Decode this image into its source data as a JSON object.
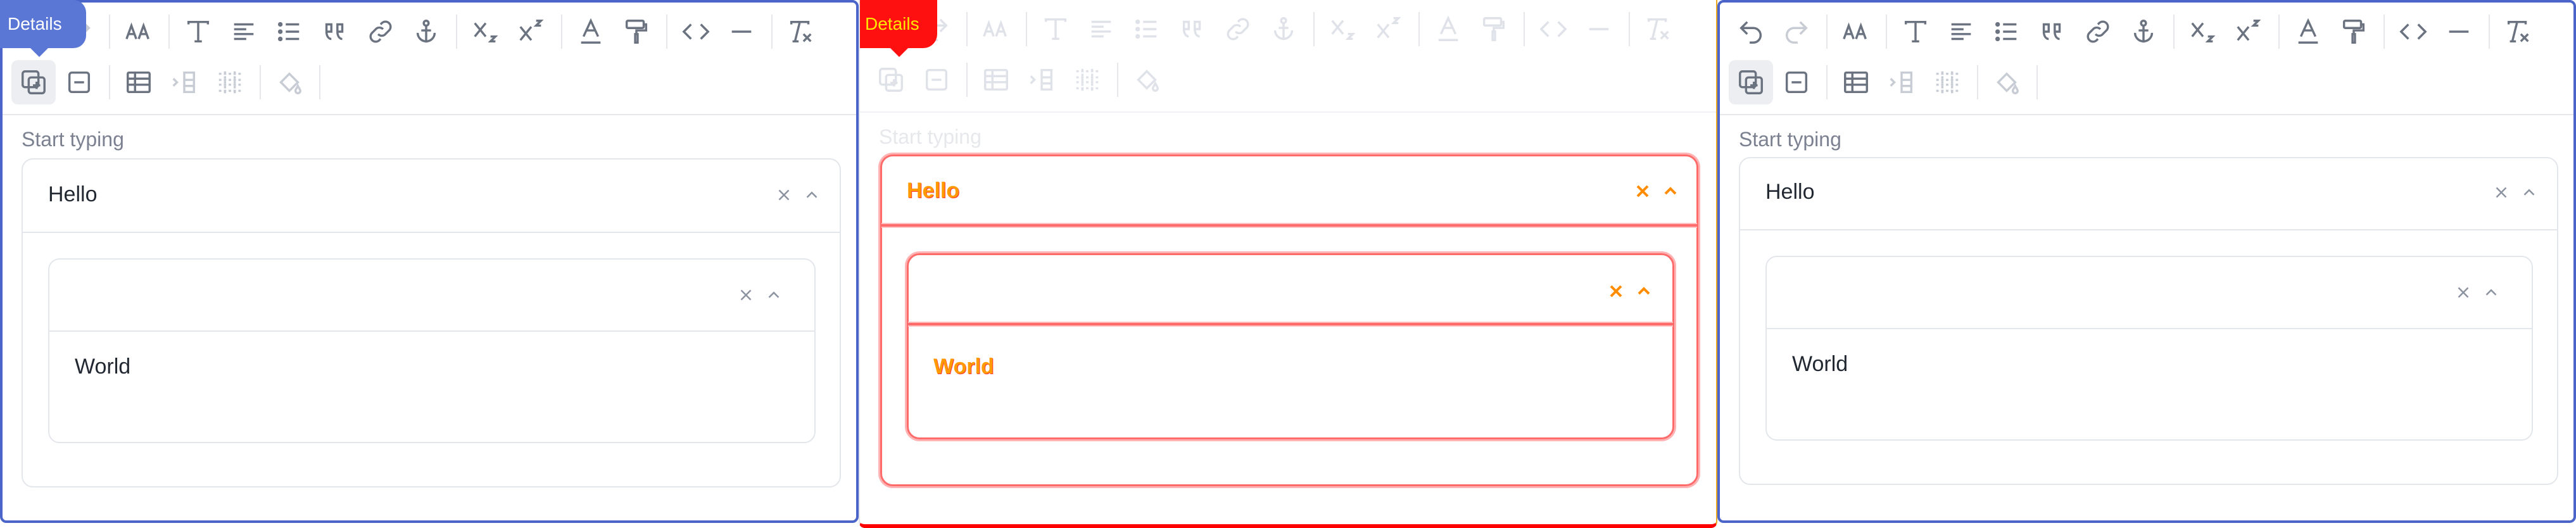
{
  "toolbar": {
    "row1": [
      "undo-icon",
      "redo-icon",
      "font-size-icon",
      "|",
      "text-style-icon",
      "align-icon",
      "list-icon",
      "blockquote-icon",
      "link-icon",
      "anchor-icon",
      "|",
      "subscript-icon",
      "superscript-icon",
      "|",
      "text-color-icon",
      "format-painter-icon",
      "|",
      "code-icon",
      "horizontal-rule-icon",
      "|",
      "clear-format-icon"
    ],
    "row2": [
      "add-details-icon",
      "remove-details-icon",
      "|",
      "table-icon",
      "table-column-icon",
      "table-rows-icon",
      "|",
      "fill-color-icon"
    ]
  },
  "tooltip": {
    "label": "Details"
  },
  "editor": {
    "placeholder": "Start typing",
    "outer_title": "Hello",
    "inner_title": "",
    "inner_content": "World"
  },
  "colors": {
    "panel_border": "#4a64c9",
    "tooltip_bg": "#5b77d6",
    "diff_red": "#ff0000",
    "diff_orange": "#ff9a00"
  }
}
